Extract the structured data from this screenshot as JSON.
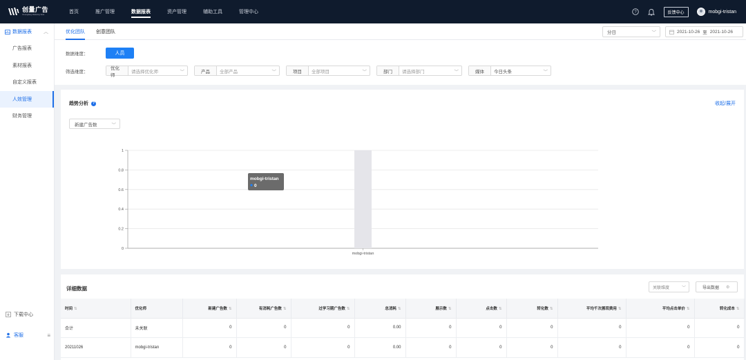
{
  "brand": {
    "name": "创量广告",
    "tagline": "Chuangliang Marketing Tools"
  },
  "nav": {
    "items": [
      "首页",
      "推广管理",
      "数据报表",
      "资产管理",
      "辅助工具",
      "管理中心"
    ],
    "active": 2,
    "feedback": "反馈中心",
    "user": "mobgi-tristan"
  },
  "sidebar": {
    "section": "数据报表",
    "items": [
      "广告报表",
      "素材报表",
      "自定义报表",
      "人效管理",
      "财务管理"
    ],
    "active": 3,
    "download": "下载中心",
    "service": "客服"
  },
  "tabs": {
    "items": [
      "优化团队",
      "创意团队"
    ],
    "active": 0
  },
  "toolbar": {
    "granularity": "分日",
    "date_start": "2021-10-26",
    "date_sep": "至",
    "date_end": "2021-10-26"
  },
  "filters": {
    "dimension_label": "数据维度：",
    "dimension_value": "人员",
    "filter_label": "筛选维度：",
    "groups": [
      {
        "label": "优化师",
        "value": "请选择优化师",
        "filled": false
      },
      {
        "label": "产品",
        "value": "全部产品",
        "filled": false
      },
      {
        "label": "项目",
        "value": "全部项目",
        "filled": false
      },
      {
        "label": "部门",
        "value": "请选择部门",
        "filled": false
      },
      {
        "label": "媒体",
        "value": "今日头条",
        "filled": true
      }
    ]
  },
  "trend": {
    "title": "趋势分析",
    "collapse": "收起/展开",
    "metric": "新建广告数",
    "tooltip_name": "mobgi-tristan",
    "tooltip_value": "0"
  },
  "chart_data": {
    "type": "bar",
    "categories": [
      "mobgi-tristan"
    ],
    "values": [
      0
    ],
    "ylim": [
      0,
      1
    ],
    "yticks": [
      "0",
      "0.2",
      "0.4",
      "0.6",
      "0.8",
      "1"
    ],
    "grid": true,
    "title": "",
    "xlabel": "",
    "ylabel": ""
  },
  "detail": {
    "title": "详细数据",
    "assoc": "关联维度",
    "export": "导出数据",
    "columns": [
      "时间",
      "优化师",
      "新建广告数",
      "有消耗广告数",
      "过学习期广告数",
      "总消耗",
      "展示数",
      "点击数",
      "转化数",
      "平均千次展现费用",
      "平均点击单价",
      "转化成本"
    ],
    "rows": [
      [
        "合计",
        "未关联",
        "0",
        "0",
        "0",
        "0.00",
        "0",
        "0",
        "0",
        "0",
        "0",
        "0"
      ],
      [
        "20211026",
        "mobgi-tristan",
        "0",
        "0",
        "0",
        "0.00",
        "0",
        "0",
        "0",
        "0",
        "0",
        "0"
      ]
    ]
  },
  "colors": {
    "nav_bg": "#0f1b2d",
    "accent": "#1e6fe8",
    "button": "#1e80f5"
  }
}
